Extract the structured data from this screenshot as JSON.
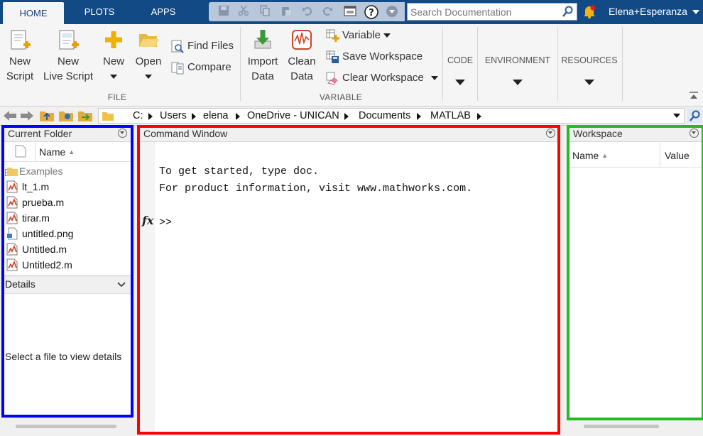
{
  "tabs": [
    {
      "label": "HOME",
      "active": true
    },
    {
      "label": "PLOTS",
      "active": false
    },
    {
      "label": "APPS",
      "active": false
    }
  ],
  "quick_access": {
    "icons": [
      "save-icon",
      "cut-icon",
      "copy-icon",
      "paste-icon",
      "undo-icon",
      "redo-icon",
      "switch-windows-icon",
      "help-icon",
      "customize-icon"
    ]
  },
  "search": {
    "placeholder": "Search Documentation"
  },
  "user": {
    "name": "Elena+Esperanza"
  },
  "ribbon": {
    "file": {
      "new_script": [
        "New",
        "Script"
      ],
      "new_live_script": [
        "New",
        "Live Script"
      ],
      "new": "New",
      "open": "Open",
      "find_files": "Find Files",
      "compare": "Compare",
      "label": "FILE"
    },
    "variable": {
      "import_data": [
        "Import",
        "Data"
      ],
      "clean_data": [
        "Clean",
        "Data"
      ],
      "variable": "Variable",
      "save_workspace": "Save Workspace",
      "clear_workspace": "Clear Workspace",
      "label": "VARIABLE"
    },
    "collapsed": {
      "code": "CODE",
      "environment": "ENVIRONMENT",
      "resources": "RESOURCES"
    }
  },
  "address": {
    "path": [
      "C:",
      "Users",
      "elena",
      "OneDrive - UNICAN",
      "Documents",
      "MATLAB"
    ]
  },
  "current_folder": {
    "title": "Current Folder",
    "column": "Name",
    "items": [
      {
        "name": "Examples",
        "type": "folder"
      },
      {
        "name": "lt_1.m",
        "type": "m"
      },
      {
        "name": "prueba.m",
        "type": "m"
      },
      {
        "name": "tirar.m",
        "type": "m"
      },
      {
        "name": "untitled.png",
        "type": "png"
      },
      {
        "name": "Untitled.m",
        "type": "m"
      },
      {
        "name": "Untitled2.m",
        "type": "m"
      }
    ],
    "details_title": "Details",
    "details_message": "Select a file to view details"
  },
  "command_window": {
    "title": "Command Window",
    "lines": [
      "To get started, type doc.",
      "For product information, visit www.mathworks.com."
    ],
    "prompt": ">>",
    "fx": "fx"
  },
  "workspace": {
    "title": "Workspace",
    "columns": [
      "Name",
      "Value"
    ]
  },
  "colors": {
    "top_bar": "#124a85",
    "highlight_current_folder": "#0000ff",
    "highlight_command_window": "#ff0000",
    "highlight_workspace": "#22bb22"
  }
}
